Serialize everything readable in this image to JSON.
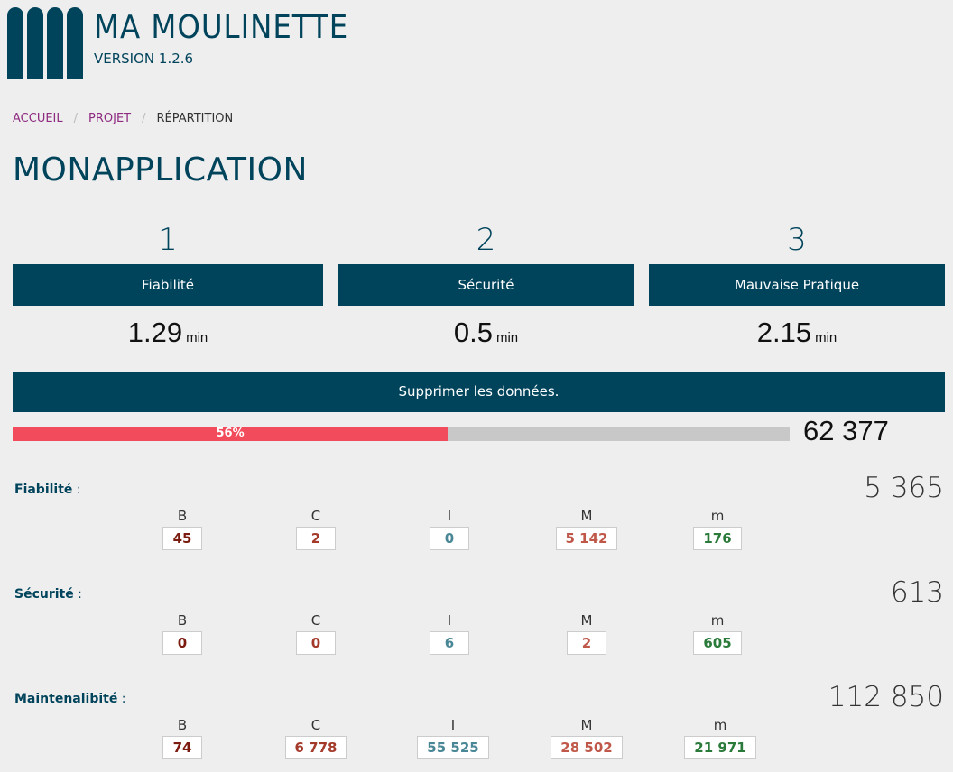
{
  "brand": {
    "title": "MA MOULINETTE",
    "version": "VERSION 1.2.6",
    "logo_icon": "mm-logo-icon",
    "color": "#00445c"
  },
  "breadcrumb": {
    "items": [
      {
        "label": "ACCUEIL",
        "link": true
      },
      {
        "label": "PROJET",
        "link": true
      },
      {
        "label": "RÉPARTITION",
        "link": false
      }
    ],
    "separator": "/"
  },
  "page_title": "MONAPPLICATION",
  "cards": [
    {
      "number": "1",
      "label": "Fiabilité",
      "value": "1.29",
      "unit": "min"
    },
    {
      "number": "2",
      "label": "Sécurité",
      "value": "0.5",
      "unit": "min"
    },
    {
      "number": "3",
      "label": "Mauvaise Pratique",
      "value": "2.15",
      "unit": "min"
    }
  ],
  "delete_button": "Supprimer les données.",
  "progress": {
    "percent": 56,
    "label": "56%",
    "total": "62 377",
    "fill_color": "#f24b5b"
  },
  "sections": [
    {
      "label": "Fiabilité",
      "suffix": " :",
      "total": "5 365",
      "items": [
        {
          "letter": "B",
          "value": "45",
          "color": "#7b1a0e"
        },
        {
          "letter": "C",
          "value": "2",
          "color": "#a33a2a"
        },
        {
          "letter": "I",
          "value": "0",
          "color": "#4a8796"
        },
        {
          "letter": "M",
          "value": "5 142",
          "color": "#c0584a"
        },
        {
          "letter": "m",
          "value": "176",
          "color": "#2a7a3a"
        }
      ]
    },
    {
      "label": "Sécurité",
      "suffix": " :",
      "total": "613",
      "items": [
        {
          "letter": "B",
          "value": "0",
          "color": "#7b1a0e"
        },
        {
          "letter": "C",
          "value": "0",
          "color": "#a33a2a"
        },
        {
          "letter": "I",
          "value": "6",
          "color": "#4a8796"
        },
        {
          "letter": "M",
          "value": "2",
          "color": "#c0584a"
        },
        {
          "letter": "m",
          "value": "605",
          "color": "#2a7a3a"
        }
      ]
    },
    {
      "label": "Maintenalibité",
      "suffix": " :",
      "total": "112 850",
      "items": [
        {
          "letter": "B",
          "value": "74",
          "color": "#7b1a0e"
        },
        {
          "letter": "C",
          "value": "6 778",
          "color": "#a33a2a"
        },
        {
          "letter": "I",
          "value": "55 525",
          "color": "#4a8796"
        },
        {
          "letter": "M",
          "value": "28 502",
          "color": "#c0584a"
        },
        {
          "letter": "m",
          "value": "21 971",
          "color": "#2a7a3a"
        }
      ]
    }
  ]
}
